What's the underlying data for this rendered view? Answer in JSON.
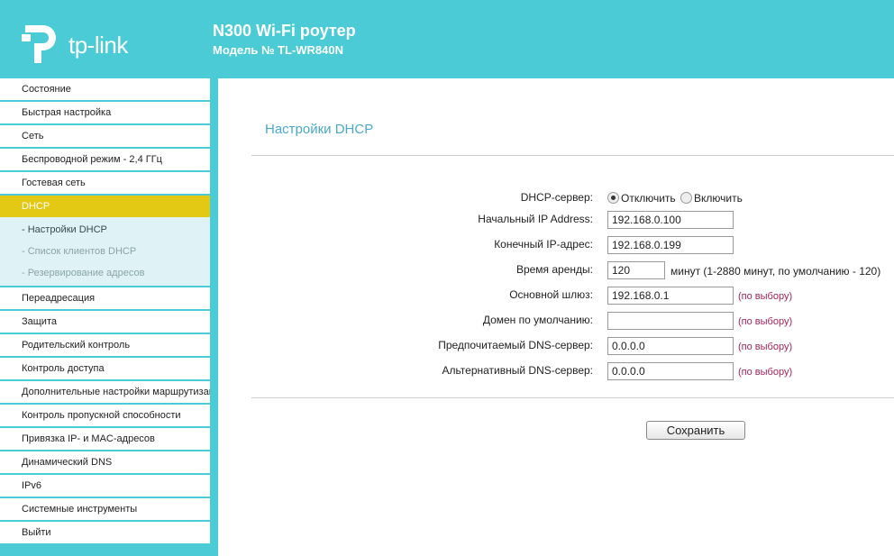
{
  "header": {
    "logo_text": "tp-link",
    "title": "N300 Wi-Fi роутер",
    "model": "Модель № TL-WR840N"
  },
  "sidebar": {
    "items_before": [
      {
        "label": "Состояние"
      },
      {
        "label": "Быстрая настройка"
      },
      {
        "label": "Сеть"
      },
      {
        "label": "Беспроводной режим - 2,4 ГГц"
      },
      {
        "label": "Гостевая сеть"
      }
    ],
    "active": {
      "label": "DHCP"
    },
    "subitems": [
      {
        "label": "- Настройки DHCP"
      },
      {
        "label": "- Список клиентов DHCP"
      },
      {
        "label": "- Резервирование адресов"
      }
    ],
    "items_after": [
      {
        "label": "Переадресация"
      },
      {
        "label": "Защита"
      },
      {
        "label": "Родительский контроль"
      },
      {
        "label": "Контроль доступа"
      },
      {
        "label": "Дополнительные настройки маршрутизации"
      },
      {
        "label": "Контроль пропускной способности"
      },
      {
        "label": "Привязка IP- и MAC-адресов"
      },
      {
        "label": "Динамический DNS"
      },
      {
        "label": "IPv6"
      },
      {
        "label": "Системные инструменты"
      },
      {
        "label": "Выйти"
      }
    ]
  },
  "page": {
    "title": "Настройки DHCP",
    "dhcp_server": {
      "label": "DHCP-сервер:",
      "option_off": "Отключить",
      "option_on": "Включить",
      "selected": "off"
    },
    "start_ip": {
      "label": "Начальный IP Address:",
      "value": "192.168.0.100"
    },
    "end_ip": {
      "label": "Конечный IP-адрес:",
      "value": "192.168.0.199"
    },
    "lease": {
      "label": "Время аренды:",
      "value": "120",
      "note": "минут (1-2880 минут, по умолчанию - 120)"
    },
    "gateway": {
      "label": "Основной шлюз:",
      "value": "192.168.0.1",
      "hint": "(по выбору)"
    },
    "domain": {
      "label": "Домен по умолчанию:",
      "value": "",
      "hint": "(по выбору)"
    },
    "dns1": {
      "label": "Предпочитаемый DNS-сервер:",
      "value": "0.0.0.0",
      "hint": "(по выбору)"
    },
    "dns2": {
      "label": "Альтернативный DNS-сервер:",
      "value": "0.0.0.0",
      "hint": "(по выбору)"
    },
    "save_label": "Сохранить"
  },
  "colors": {
    "brand": "#4acbd6",
    "active_menu": "#e4c914",
    "title": "#4aa9c7",
    "hint": "#a0245a"
  }
}
